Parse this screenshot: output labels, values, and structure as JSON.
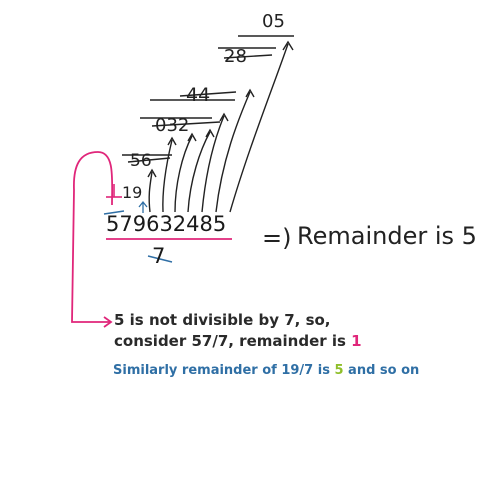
{
  "number": "579632485",
  "divisor": "7",
  "steps": [
    "19",
    "56",
    "032",
    "44",
    "28",
    "05"
  ],
  "carry_digit": "1",
  "arrow_glyph": "=)",
  "result": "Remainder is 5",
  "note": {
    "line1": "5 is not divisible by 7, so,",
    "line2_prefix": "consider 57/7, remainder is ",
    "line2_value": "1"
  },
  "note2": {
    "prefix": "Similarly remainder of 19/7 is ",
    "value": "5",
    "suffix": " and so on"
  },
  "colors": {
    "pink": "#e0267a",
    "blue": "#2f6fa5",
    "green": "#8fbf2a",
    "ink": "#222222"
  }
}
